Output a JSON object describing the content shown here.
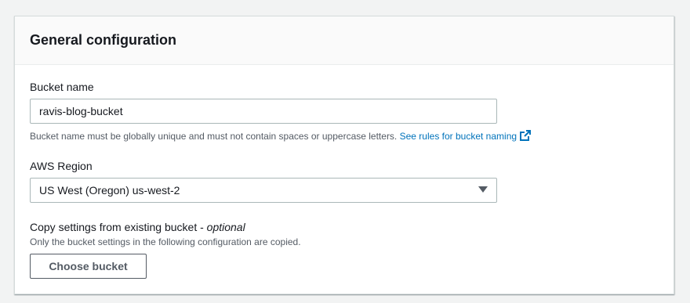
{
  "section": {
    "title": "General configuration"
  },
  "bucket_name": {
    "label": "Bucket name",
    "value": "ravis-blog-bucket",
    "hint": "Bucket name must be globally unique and must not contain spaces or uppercase letters.",
    "hint_link": "See rules for bucket naming"
  },
  "region": {
    "label": "AWS Region",
    "selected": "US West (Oregon) us-west-2"
  },
  "copy_settings": {
    "label": "Copy settings from existing bucket - ",
    "label_optional": "optional",
    "hint": "Only the bucket settings in the following configuration are copied.",
    "button_label": "Choose bucket"
  },
  "colors": {
    "link": "#0073bb",
    "text": "#16191f",
    "secondary_text": "#545b64",
    "border": "#aab7b8"
  },
  "icons": {
    "external_link": "external-link-icon",
    "dropdown": "caret-down-icon"
  }
}
